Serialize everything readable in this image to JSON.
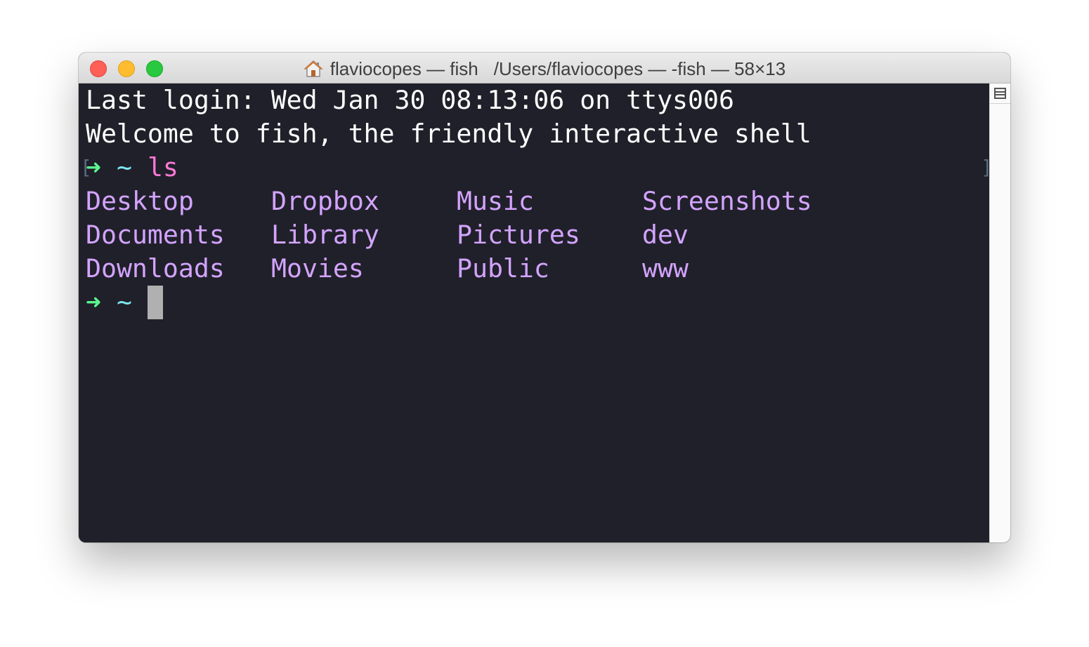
{
  "window": {
    "title_left": "flaviocopes — fish",
    "title_right": "/Users/flaviocopes — -fish — 58×13"
  },
  "terminal": {
    "last_login": "Last login: Wed Jan 30 08:13:06 on ttys006",
    "welcome": "Welcome to fish, the friendly interactive shell",
    "prompt_arrow": "➜",
    "prompt_dir": "~",
    "command": "ls",
    "listing": [
      [
        "Desktop",
        "Dropbox",
        "Music",
        "Screenshots"
      ],
      [
        "Documents",
        "Library",
        "Pictures",
        "dev"
      ],
      [
        "Downloads",
        "Movies",
        "Public",
        "www"
      ]
    ]
  },
  "colors": {
    "background": "#20202a",
    "prompt_arrow": "#5af78e",
    "prompt_dir": "#7ee6f0",
    "command": "#ff79d6",
    "directory": "#d3a4ff"
  },
  "icons": {
    "title": "home-icon",
    "scrollbar": "split-pane-icon"
  }
}
